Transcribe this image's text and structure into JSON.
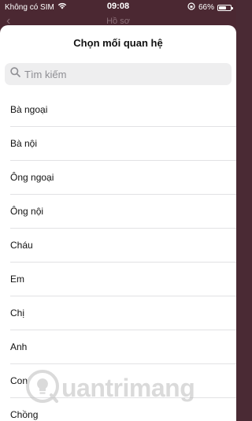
{
  "status_bar": {
    "carrier": "Không có SIM",
    "time": "09:08",
    "battery": "66%",
    "battery_level": 0.66,
    "icons": [
      "wifi-icon",
      "orientation-lock-icon",
      "battery-icon"
    ]
  },
  "background_screen": {
    "title": "Hồ sơ"
  },
  "sheet": {
    "title": "Chọn mối quan hệ",
    "search": {
      "placeholder": "Tìm kiếm",
      "value": ""
    },
    "items": [
      {
        "label": "Bà ngoại"
      },
      {
        "label": "Bà nội"
      },
      {
        "label": "Ông ngoại"
      },
      {
        "label": "Ông nội"
      },
      {
        "label": "Cháu"
      },
      {
        "label": "Em"
      },
      {
        "label": "Chị"
      },
      {
        "label": "Anh"
      },
      {
        "label": "Con"
      },
      {
        "label": "Chồng"
      }
    ]
  },
  "watermark": {
    "text": "uantrimang"
  }
}
